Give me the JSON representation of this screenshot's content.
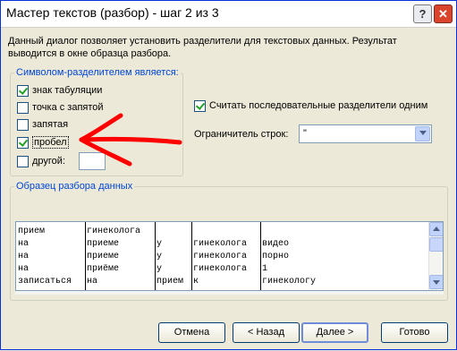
{
  "window": {
    "title": "Мастер текстов (разбор) - шаг 2 из 3",
    "help_glyph": "?",
    "close_glyph": "✕"
  },
  "description": "Данный диалог позволяет установить разделители для текстовых данных. Результат выводится в окне образца разбора.",
  "delimiters": {
    "legend": "Символом-разделителем является:",
    "items": [
      {
        "label": "знак табуляции",
        "checked": true
      },
      {
        "label": "точка с запятой",
        "checked": false
      },
      {
        "label": "запятая",
        "checked": false
      },
      {
        "label": "пробел",
        "checked": true
      },
      {
        "label": "другой:",
        "checked": false
      }
    ],
    "other_value": ""
  },
  "consecutive": {
    "label": "Считать последовательные разделители одним",
    "checked": true
  },
  "text_qualifier": {
    "label": "Ограничитель строк:",
    "value": "\""
  },
  "preview": {
    "legend": "Образец разбора данных",
    "rows": [
      [
        "прием",
        "гинеколога",
        "",
        "",
        ""
      ],
      [
        "на",
        "приеме",
        "у",
        "гинеколога",
        "видео"
      ],
      [
        "на",
        "приеме",
        "у",
        "гинеколога",
        "порно"
      ],
      [
        "на",
        "приёме",
        "у",
        "гинеколога",
        "1"
      ],
      [
        "записаться",
        "на",
        "прием",
        "к",
        "гинекологу"
      ]
    ]
  },
  "buttons": {
    "cancel": "Отмена",
    "back": "< Назад",
    "next": "Далее >",
    "finish": "Готово"
  },
  "icons": {
    "help": "help-icon",
    "close": "close-icon",
    "dropdown": "chevron-down-icon",
    "scroll_up": "scroll-up-icon",
    "scroll_down": "scroll-down-icon",
    "annotation": "red-arrow-annotation"
  },
  "colors": {
    "accent_border": "#0831d9",
    "legend_text": "#0046d5",
    "annotation_arrow": "#ff0000",
    "check_mark": "#21a121"
  }
}
